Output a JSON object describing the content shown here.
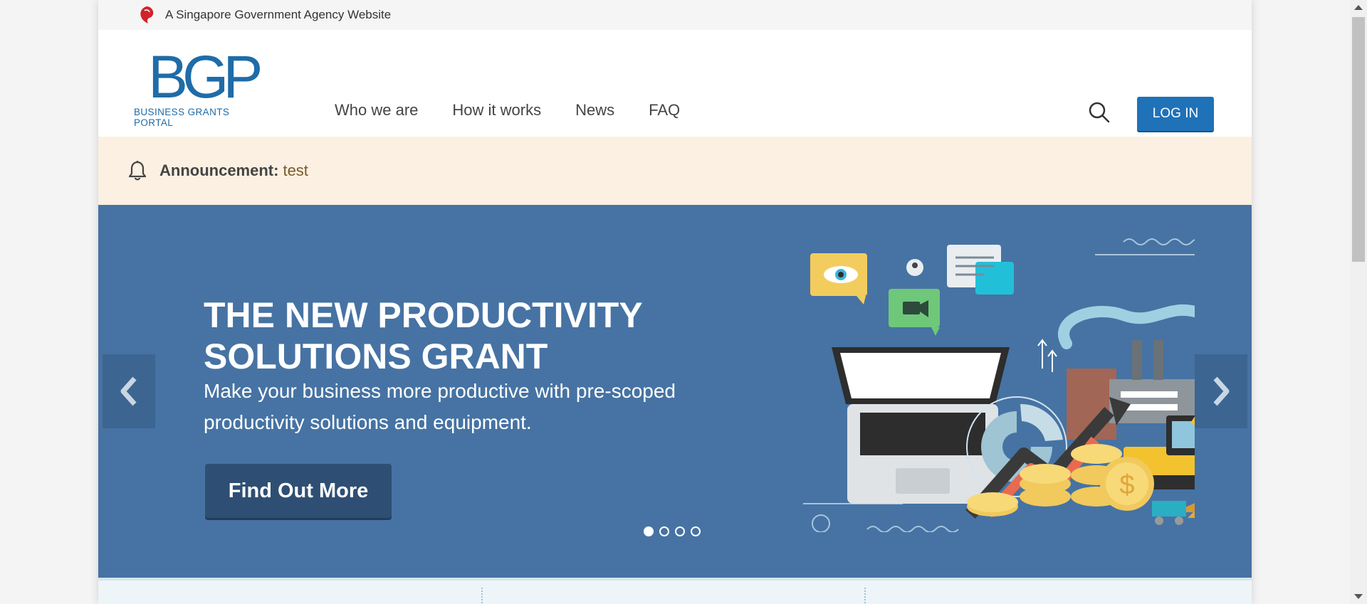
{
  "masthead": {
    "text": "A Singapore Government Agency Website"
  },
  "logo": {
    "mark": "BGP",
    "subtitle": "BUSINESS GRANTS PORTAL"
  },
  "nav": {
    "items": [
      "Who we are",
      "How it works",
      "News",
      "FAQ"
    ]
  },
  "header": {
    "login_label": "LOG IN"
  },
  "announcement": {
    "label": "Announcement:",
    "text": "test"
  },
  "hero": {
    "title": "THE NEW PRODUCTIVITY SOLUTIONS GRANT",
    "description": "Make your business more productive with pre-scoped productivity solutions and equipment.",
    "cta_label": "Find Out More",
    "slides_total": 4,
    "active_slide": 1
  },
  "colors": {
    "brand_blue": "#1e6ca8",
    "hero_bg": "#4673a3",
    "cta_bg": "#2e4f73",
    "announcement_bg": "#fbf0e1"
  }
}
